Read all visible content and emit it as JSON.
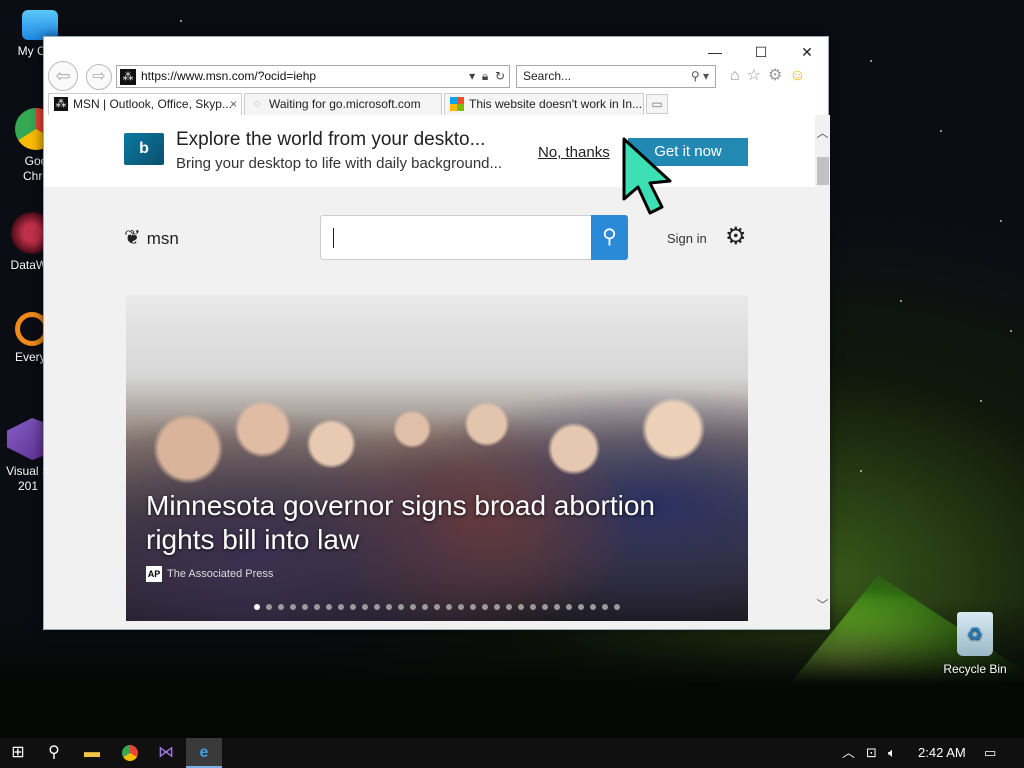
{
  "desktop": {
    "icons": [
      {
        "label": "My Com",
        "icon": "computer-icon"
      },
      {
        "label": "Goo",
        "label2": "Chro",
        "icon": "chrome-icon"
      },
      {
        "label": "DataWa",
        "icon": "datawarrior-icon"
      },
      {
        "label": "Everyt",
        "icon": "everything-search-icon"
      },
      {
        "label": "Visual S",
        "label2": "201",
        "icon": "visual-studio-icon"
      }
    ],
    "recycle_bin": "Recycle Bin"
  },
  "browser": {
    "address": "https://www.msn.com/?ocid=iehp",
    "search_placeholder": "Search...",
    "tabs": [
      {
        "label": "MSN | Outlook, Office, Skyp...",
        "close": "×"
      },
      {
        "label": "Waiting for go.microsoft.com"
      },
      {
        "label": "This website doesn't work in In..."
      }
    ],
    "window_buttons": {
      "minimize": "—",
      "maximize": "☐",
      "close": "✕"
    }
  },
  "promo": {
    "title": "Explore the world from your deskto...",
    "subtitle": "Bring your desktop to life with daily background...",
    "no_thanks": "No, thanks",
    "get_now": "Get it now",
    "logo": "b"
  },
  "msn": {
    "logo_text": "msn",
    "sign_in": "Sign in",
    "hero_title": "Minnesota governor signs broad abortion rights bill into law",
    "hero_source": "The Associated Press",
    "hero_source_badge": "AP",
    "carousel_count": 31,
    "carousel_active": 0
  },
  "taskbar": {
    "time": "2:42 AM"
  },
  "colors": {
    "get_now_bg": "#2289b3",
    "search_button": "#2a8ad8",
    "cursor": "#3de0b4"
  }
}
